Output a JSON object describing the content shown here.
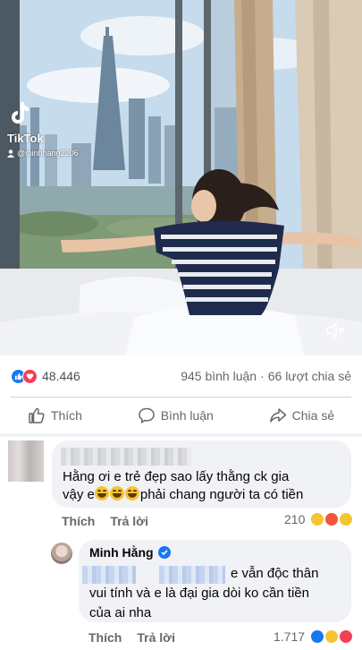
{
  "video": {
    "watermark_app": "TikTok",
    "watermark_handle": "@minhhang2206"
  },
  "stats": {
    "reaction_count": "48.446",
    "comments": "945 bình luận",
    "separator": "·",
    "shares": "66 lượt chia sẻ"
  },
  "actions": {
    "like": "Thích",
    "comment": "Bình luận",
    "share": "Chia sẻ"
  },
  "comments": [
    {
      "text_line1": "Hằng ơi e trẻ đẹp sao lấy thằng ck gia",
      "text_line2_pre": "vậy e",
      "text_line2_post": "phải chang người ta có tiền",
      "like_label": "Thích",
      "reply_label": "Trả lời",
      "reaction_count": "210"
    },
    {
      "author": "Minh Hằng",
      "text_line1": "e vẫn độc thân",
      "text_line2": "vui tính và e là đại gia dòi ko cần tiền",
      "text_line3": "của ai nha",
      "like_label": "Thích",
      "reply_label": "Trả lời",
      "reaction_count": "1.717"
    }
  ],
  "colors": {
    "facebook_blue": "#1877f2",
    "love_red": "#f33e58",
    "bubble_gray": "#f0f2f5",
    "meta_gray": "#65676b"
  }
}
